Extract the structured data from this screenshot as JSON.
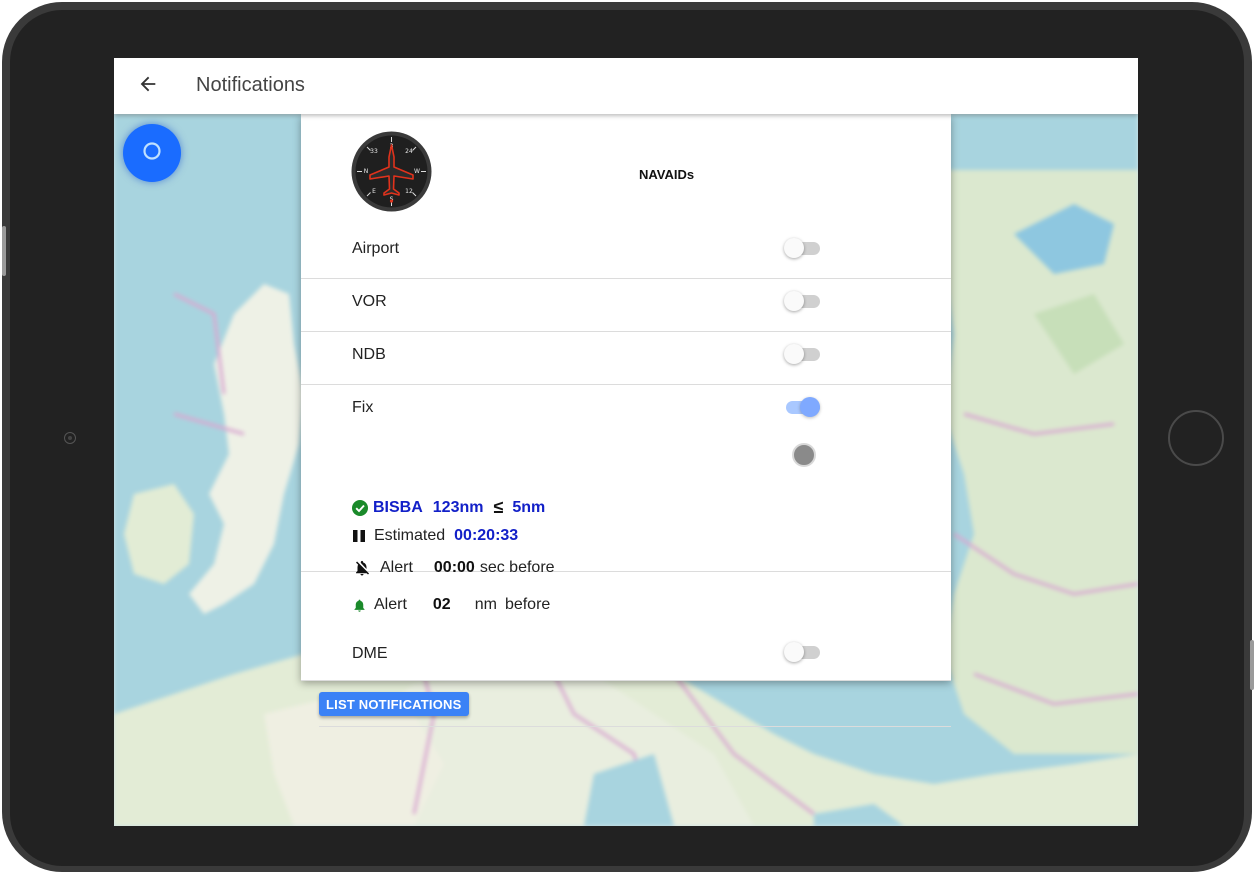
{
  "appbar": {
    "title": "Notifications"
  },
  "icons": {
    "back": "arrow-left-icon",
    "locate": "location-icon",
    "compass": "compass-plane-icon",
    "check": "check-circle-icon",
    "pause": "pause-icon",
    "bell_off": "bell-off-icon",
    "bell": "bell-icon"
  },
  "panel": {
    "title": "NAVAIDs",
    "rows": [
      {
        "label": "Airport",
        "enabled": false
      },
      {
        "label": "VOR",
        "enabled": false
      },
      {
        "label": "NDB",
        "enabled": false
      },
      {
        "label": "Fix",
        "enabled": true
      },
      {
        "label": "DME",
        "enabled": false
      }
    ],
    "fix_detail": {
      "name": "BISBA",
      "distance": "123nm",
      "comparator": "≤",
      "threshold": "5nm",
      "estimated_label": "Estimated",
      "estimated_time": "00:20:33",
      "alert_time_label": "Alert",
      "alert_time_value": "00:00",
      "alert_time_suffix": "sec before",
      "alert_nm_label": "Alert",
      "alert_nm_value": "02",
      "alert_nm_unit": "nm",
      "alert_nm_suffix": "before"
    },
    "list_button": "LIST NOTIFICATIONS"
  },
  "colors": {
    "accent": "#3b82f6",
    "fix_text": "#1220c8",
    "ok_green": "#1a8a2a",
    "fab": "#1a6cff"
  }
}
